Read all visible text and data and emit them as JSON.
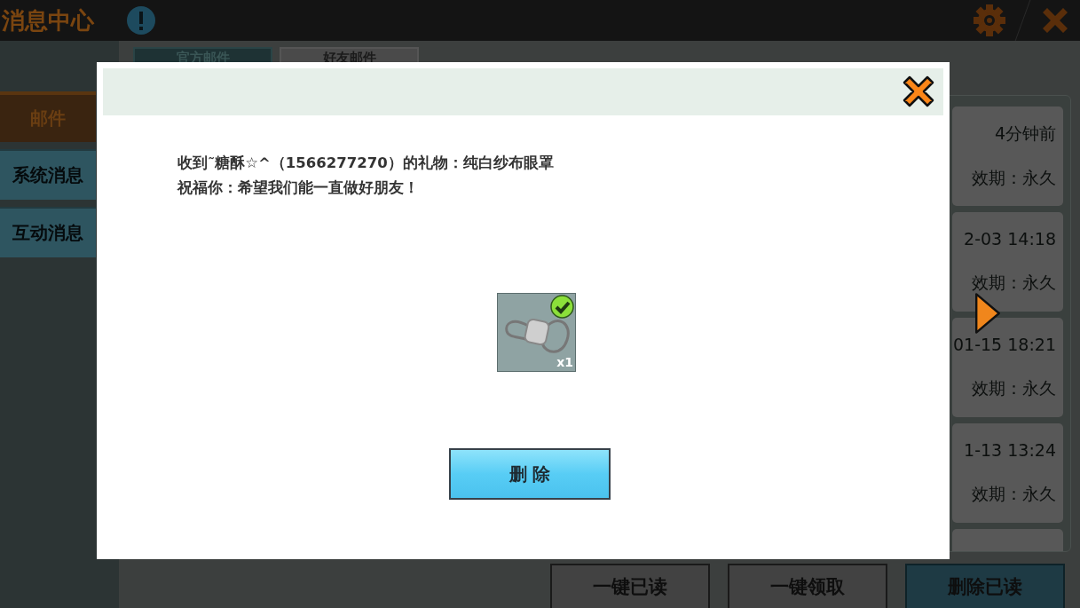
{
  "app": {
    "title": "消息中心"
  },
  "sidebar": {
    "items": [
      {
        "label": "邮件",
        "selected": true
      },
      {
        "label": "系统消息",
        "selected": false
      },
      {
        "label": "互动消息",
        "selected": false
      }
    ]
  },
  "tabs": [
    {
      "label": "官方邮件",
      "selected": true
    },
    {
      "label": "好友邮件",
      "selected": false
    }
  ],
  "mail_list": [
    {
      "time": "4分钟前",
      "validity": "效期：永久"
    },
    {
      "time": "2-03 14:18",
      "validity": "效期：永久"
    },
    {
      "time": "01-15 18:21",
      "validity": "效期：永久"
    },
    {
      "time": "1-13 13:24",
      "validity": "效期：永久"
    }
  ],
  "actions": [
    {
      "label": "一键已读",
      "kind": "normal"
    },
    {
      "label": "一键领取",
      "kind": "normal"
    },
    {
      "label": "删除已读",
      "kind": "primary"
    }
  ],
  "dialog": {
    "message": "收到˜糖酥☆^（1566277270）的礼物：纯白纱布眼罩",
    "blessing": "祝福你：希望我们能一直做好朋友！",
    "item": {
      "quantity": "x1",
      "checked": true
    },
    "delete_button": "删 除"
  }
}
